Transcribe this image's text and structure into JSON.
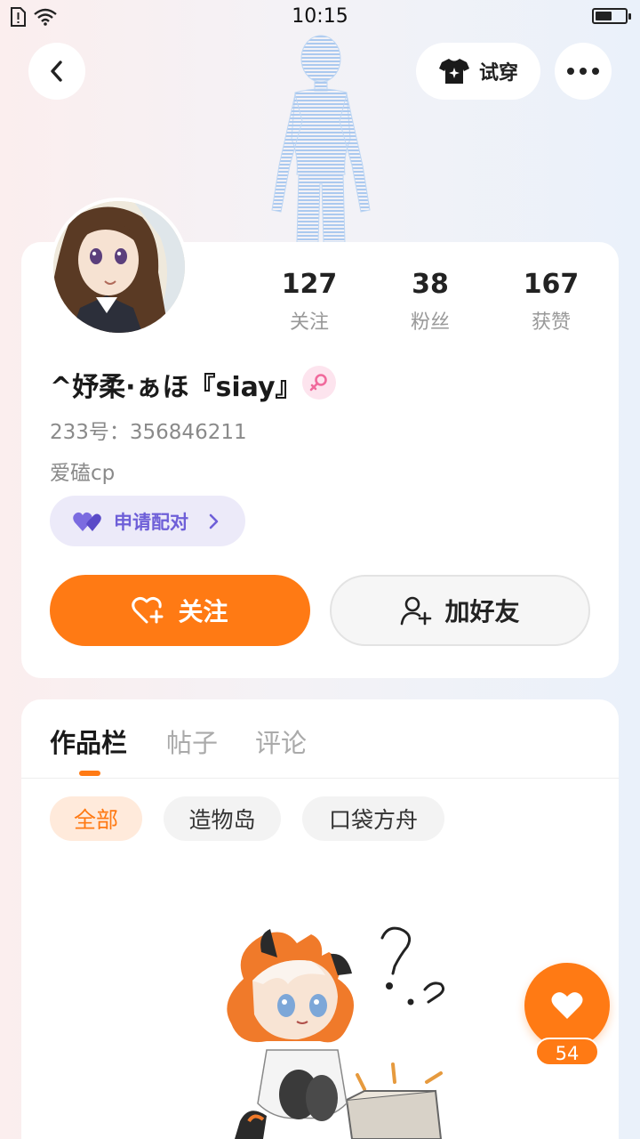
{
  "status_bar": {
    "time": "10:15",
    "battery_level": 0.55
  },
  "header": {
    "back_icon": "chevron-left-icon",
    "tryon_label": "试穿",
    "tryon_icon": "tshirt-icon",
    "more_icon": "more-dots-icon"
  },
  "stats": [
    {
      "num": "127",
      "label": "关注"
    },
    {
      "num": "38",
      "label": "粉丝"
    },
    {
      "num": "167",
      "label": "获赞"
    }
  ],
  "profile": {
    "nickname": "^妤柔·ぁほ『siay』",
    "gender": "female",
    "uid": "233号：356846211",
    "bio": "爱磕cp",
    "pair_label": "申请配对"
  },
  "actions": {
    "follow_label": "关注",
    "add_friend_label": "加好友"
  },
  "tabs": [
    {
      "label": "作品栏",
      "active": true
    },
    {
      "label": "帖子",
      "active": false
    },
    {
      "label": "评论",
      "active": false
    }
  ],
  "filters": [
    {
      "label": "全部",
      "active": true
    },
    {
      "label": "造物岛",
      "active": false
    },
    {
      "label": "口袋方舟",
      "active": false
    }
  ],
  "like_float": {
    "count": "54"
  },
  "colors": {
    "accent": "#ff7a14",
    "pair_purple": "#6e5fd8",
    "gender_pink": "#f06a9c"
  }
}
